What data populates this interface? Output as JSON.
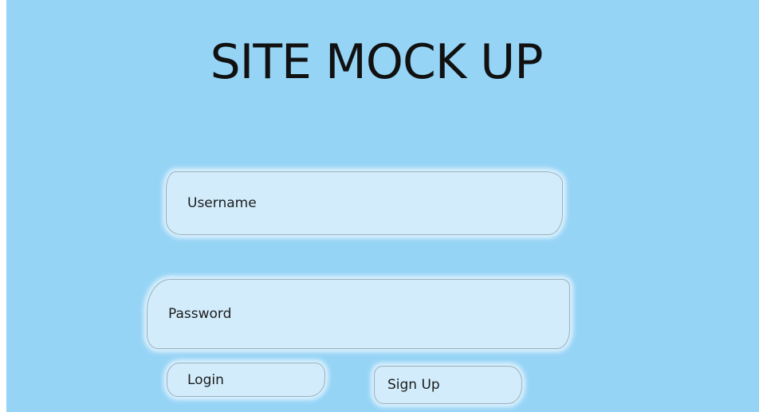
{
  "page": {
    "title": "SITE MOCK UP"
  },
  "form": {
    "username": {
      "placeholder": "Username",
      "value": ""
    },
    "password": {
      "placeholder": "Password",
      "value": ""
    },
    "login_label": "Login",
    "signup_label": "Sign Up"
  },
  "colors": {
    "background": "#96d4f6",
    "field_fill": "#d2ecfc",
    "text": "#111111"
  }
}
